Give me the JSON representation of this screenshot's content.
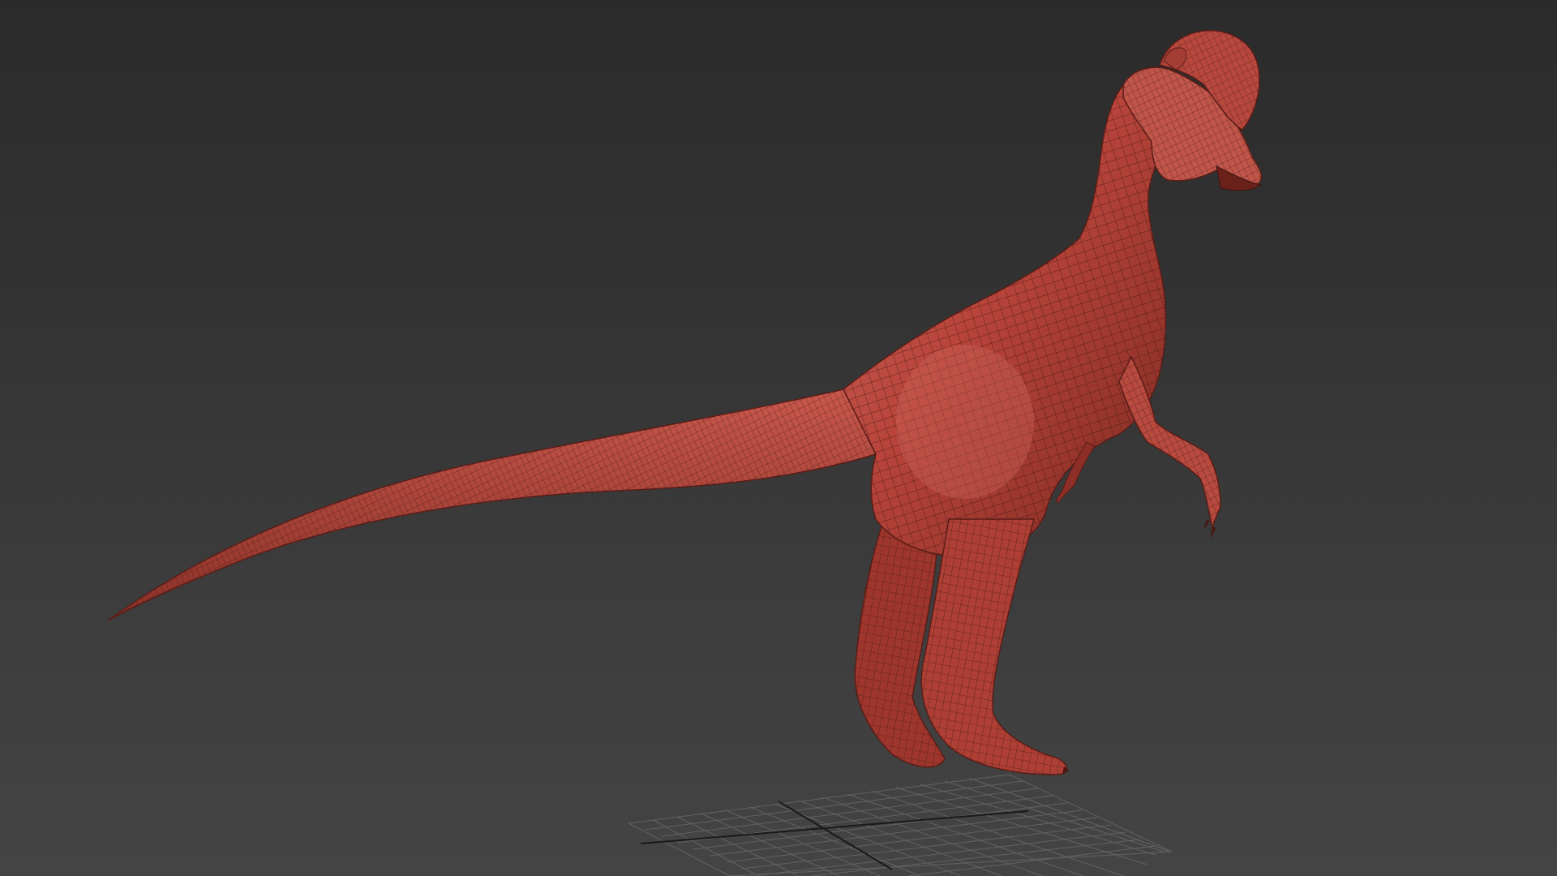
{
  "viewport": {
    "background_top": "#2b2b2b",
    "background_bottom": "#444444"
  },
  "model": {
    "subject": "dilophosaurus-wireframe",
    "base_color": "#b8443a",
    "shade_color": "#7e2a22",
    "highlight_color": "#d0675b",
    "wire_color": "#3a1410"
  },
  "grid": {
    "line_color": "#6a6a6a",
    "axis_color": "#1a1a1a"
  }
}
